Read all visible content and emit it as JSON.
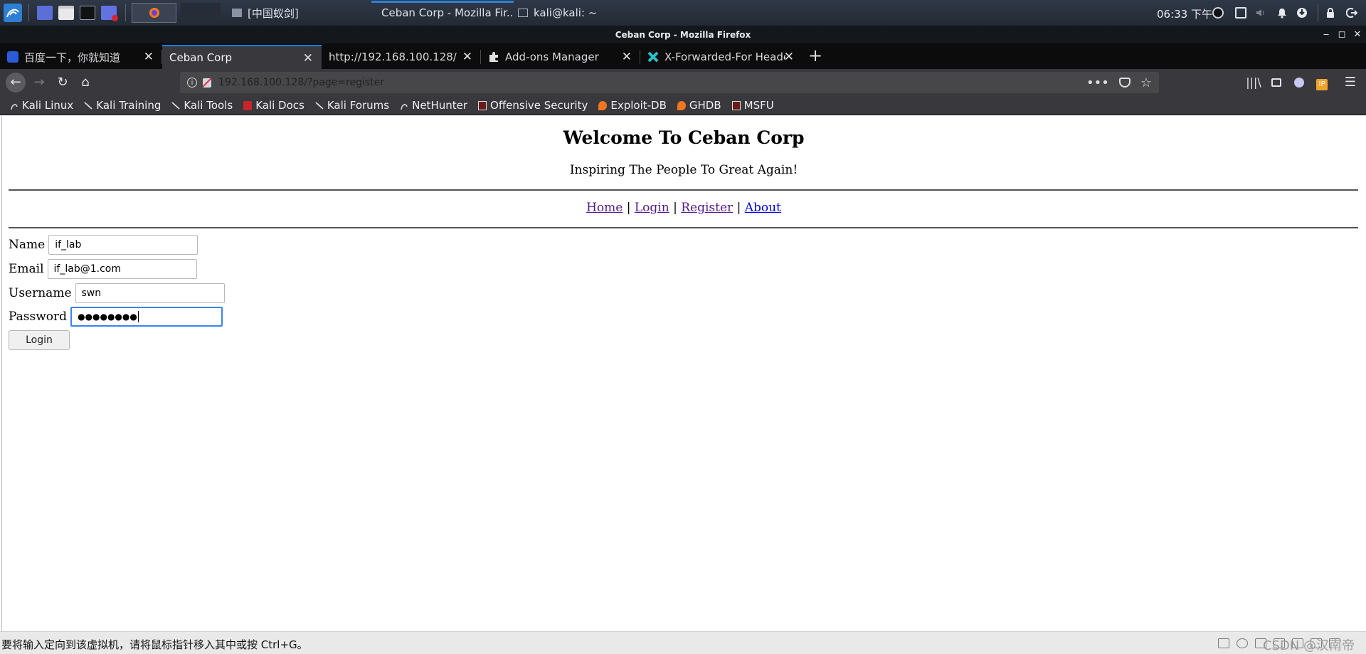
{
  "panel": {
    "tasks": [
      {
        "label": "[中国蚁剑]",
        "active": false
      },
      {
        "label": "Ceban Corp - Mozilla Fir...",
        "active": true
      },
      {
        "label": "kali@kali: ~",
        "active": false
      }
    ],
    "clock": "06:33 下午"
  },
  "window": {
    "title": "Ceban Corp - Mozilla Firefox"
  },
  "tabs": [
    {
      "label": "百度一下，你就知道",
      "selected": false
    },
    {
      "label": "Ceban Corp",
      "selected": true
    },
    {
      "label": "http://192.168.100.128/",
      "selected": false
    },
    {
      "label": "Add-ons Manager",
      "selected": false
    },
    {
      "label": "X-Forwarded-For Heade",
      "selected": false
    }
  ],
  "urlbar": {
    "host": "192.168.100.128",
    "path": "/?page=register"
  },
  "bookmarks": [
    "Kali Linux",
    "Kali Training",
    "Kali Tools",
    "Kali Docs",
    "Kali Forums",
    "NetHunter",
    "Offensive Security",
    "Exploit-DB",
    "GHDB",
    "MSFU"
  ],
  "page": {
    "title": "Welcome To Ceban Corp",
    "tagline": "Inspiring The People To Great Again!",
    "nav": {
      "home": "Home",
      "login": "Login",
      "register": "Register",
      "about": "About",
      "sep": "|"
    },
    "form": {
      "name_label": "Name",
      "name_value": "if_lab",
      "email_label": "Email",
      "email_value": "if_lab@1.com",
      "username_label": "Username",
      "username_value": "swn",
      "password_label": "Password",
      "password_value": "●●●●●●●●",
      "submit_label": "Login"
    }
  },
  "statusbar": {
    "hint": "要将输入定向到该虚拟机，请将鼠标指针移入其中或按 Ctrl+G。",
    "watermark": "CSDN @汉南帝"
  },
  "colors": {
    "accent": "#0a84ff",
    "visited_link": "#551a8b",
    "link": "#0000ee"
  }
}
